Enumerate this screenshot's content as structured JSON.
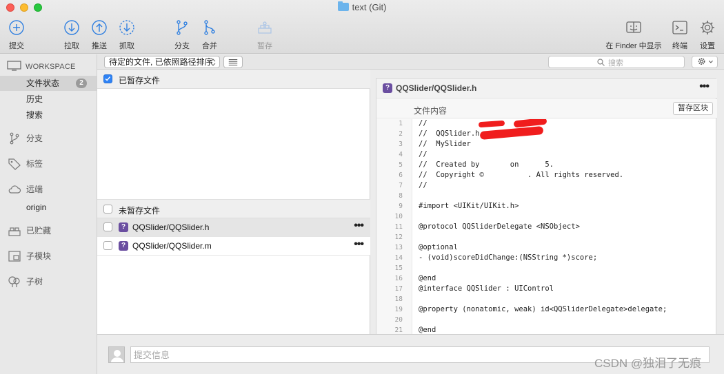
{
  "window": {
    "title": "text (Git)"
  },
  "toolbar": {
    "commit": "提交",
    "pull": "拉取",
    "push": "推送",
    "fetch": "抓取",
    "branch": "分支",
    "merge": "合并",
    "stash": "暂存",
    "show_in_finder": "在 Finder 中显示",
    "terminal": "终端",
    "settings": "设置"
  },
  "sidebar": {
    "workspace": "WORKSPACE",
    "file_status": "文件状态",
    "file_status_count": "2",
    "history": "历史",
    "search": "搜索",
    "branches": "分支",
    "tags": "标签",
    "remotes": "远端",
    "remote_origin": "origin",
    "stashes": "已贮藏",
    "submodules": "子模块",
    "subtrees": "子树"
  },
  "filterbar": {
    "sort_value": "待定的文件, 已依照路径排序",
    "search_placeholder": "搜索"
  },
  "filelist": {
    "staged_label": "已暂存文件",
    "unstaged_label": "未暂存文件",
    "files": [
      {
        "name": "QQSlider/QQSlider.h",
        "status": "?"
      },
      {
        "name": "QQSlider/QQSlider.m",
        "status": "?"
      }
    ]
  },
  "diff": {
    "path": "QQSlider/QQSlider.h",
    "section_title": "文件内容",
    "stage_hunk": "暂存区块",
    "lines": [
      "//",
      "//  QQSlider.h",
      "//  MySlider",
      "//",
      "//  Created by       on      5.",
      "//  Copyright ©          . All rights reserved.",
      "//",
      "",
      "#import <UIKit/UIKit.h>",
      "",
      "@protocol QQSliderDelegate <NSObject>",
      "",
      "@optional",
      "- (void)scoreDidChange:(NSString *)score;",
      "",
      "@end",
      "@interface QQSlider : UIControl",
      "",
      "@property (nonatomic, weak) id<QQSliderDelegate>delegate;",
      "",
      "@end"
    ],
    "line_numbers": [
      "1",
      "2",
      "3",
      "4",
      "5",
      "6",
      "7",
      "8",
      "9",
      "10",
      "11",
      "12",
      "13",
      "14",
      "15",
      "16",
      "17",
      "18",
      "19",
      "20",
      "21"
    ]
  },
  "commit": {
    "placeholder": "提交信息"
  },
  "watermark": "CSDN @独泪了无痕",
  "colors": {
    "accent": "#2f83f5",
    "status_untracked": "#6a4ea0",
    "redaction": "#f01d1d"
  }
}
